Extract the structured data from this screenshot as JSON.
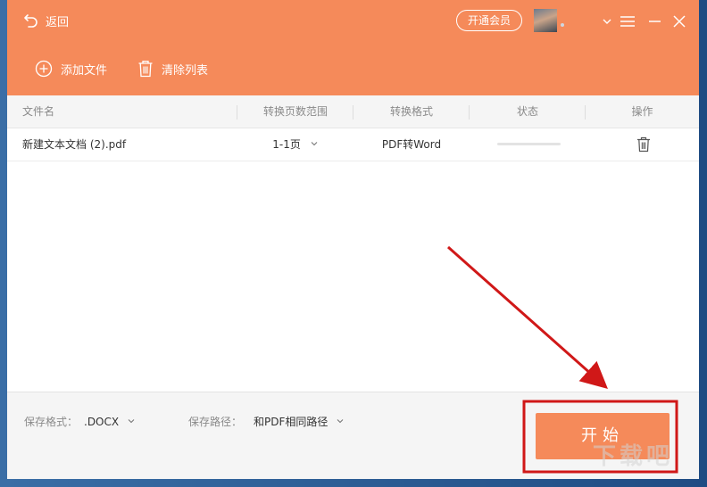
{
  "header": {
    "back_label": "返回",
    "vip_label": "开通会员",
    "add_file_label": "添加文件",
    "clear_list_label": "清除列表"
  },
  "table": {
    "columns": [
      "文件名",
      "转换页数范围",
      "转换格式",
      "状态",
      "操作"
    ],
    "rows": [
      {
        "filename": "新建文本文档 (2).pdf",
        "page_range": "1-1页",
        "format": "PDF转Word",
        "status_progress": 0
      }
    ]
  },
  "footer": {
    "save_format_label": "保存格式：",
    "save_format_value": ".DOCX",
    "save_path_label": "保存路径：",
    "save_path_value": "和PDF相同路径",
    "start_label": "开始"
  },
  "colors": {
    "accent": "#f58a5a",
    "annotation": "#d01818"
  },
  "icons": {
    "back": "back-arrow-icon",
    "add": "plus-circle-icon",
    "clear": "trash-icon",
    "delete_row": "trash-icon",
    "dropdown": "chevron-down-icon",
    "menu": "hamburger-icon",
    "minimize": "minimize-icon",
    "close": "close-icon"
  },
  "watermark": "下载吧"
}
